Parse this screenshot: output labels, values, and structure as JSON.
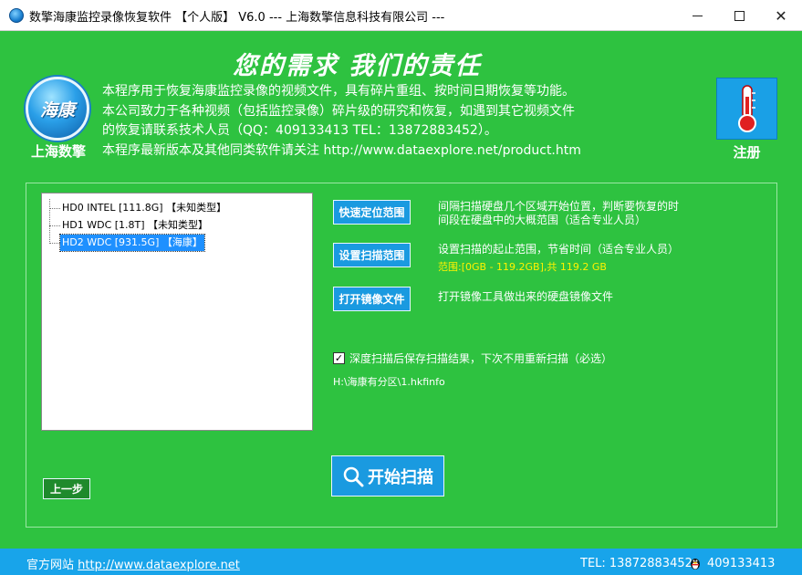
{
  "window": {
    "title": "数擎海康监控录像恢复软件 【个人版】 V6.0 --- 上海数擎信息科技有限公司 ---",
    "minimize_icon": "minimize-icon",
    "maximize_icon": "maximize-icon",
    "close_glyph": "✕"
  },
  "header": {
    "slogan": "您的需求   我们的责任",
    "logo_text": "海康",
    "logo_caption": "上海数擎",
    "description": [
      "本程序用于恢复海康监控录像的视频文件，具有碎片重组、按时间日期恢复等功能。",
      "本公司致力于各种视频（包括监控录像）碎片级的研究和恢复，如遇到其它视频文件",
      "的恢复请联系技术人员（QQ：409133413  TEL：13872883452）。",
      "本程序最新版本及其他同类软件请关注 http://www.dataexplore.net/product.htm"
    ],
    "register_label": "注册",
    "register_icon": "thermometer-icon"
  },
  "disk_tree": [
    {
      "label": "HD0  INTEL  [111.8G]  【未知类型】",
      "selected": false
    },
    {
      "label": "HD1  WDC  [1.8T]  【未知类型】",
      "selected": false
    },
    {
      "label": "HD2  WDC  [931.5G]  【海康】",
      "selected": true
    }
  ],
  "actions": {
    "quick_locate": {
      "label": "快速定位范围",
      "desc": [
        "间隔扫描硬盘几个区域开始位置，判断要恢复的时",
        "间段在硬盘中的大概范围（适合专业人员）"
      ]
    },
    "set_range": {
      "label": "设置扫描范围",
      "desc": [
        "设置扫描的起止范围，节省时间（适合专业人员）"
      ],
      "range_text": "范围:[0GB - 119.2GB],共 119.2 GB"
    },
    "open_image": {
      "label": "打开镜像文件",
      "desc": [
        "打开镜像工具做出来的硬盘镜像文件"
      ]
    }
  },
  "save_results": {
    "checked": true,
    "label": "深度扫描后保存扫描结果，下次不用重新扫描（必选）",
    "path": "H:\\海康有分区\\1.hkfinfo"
  },
  "start_button": {
    "label": "开始扫描",
    "icon": "search-icon"
  },
  "back_button": {
    "label": "上一步"
  },
  "footer": {
    "site_label": "官方网站",
    "site_url": "http://www.dataexplore.net",
    "tel": "TEL: 13872883452",
    "qq": "409133413",
    "qq_icon": "qq-penguin-icon"
  },
  "colors": {
    "background": "#2ec240",
    "accent_blue": "#1a9ae0",
    "footer_blue": "#18a4ea",
    "range_yellow": "#fff200"
  }
}
